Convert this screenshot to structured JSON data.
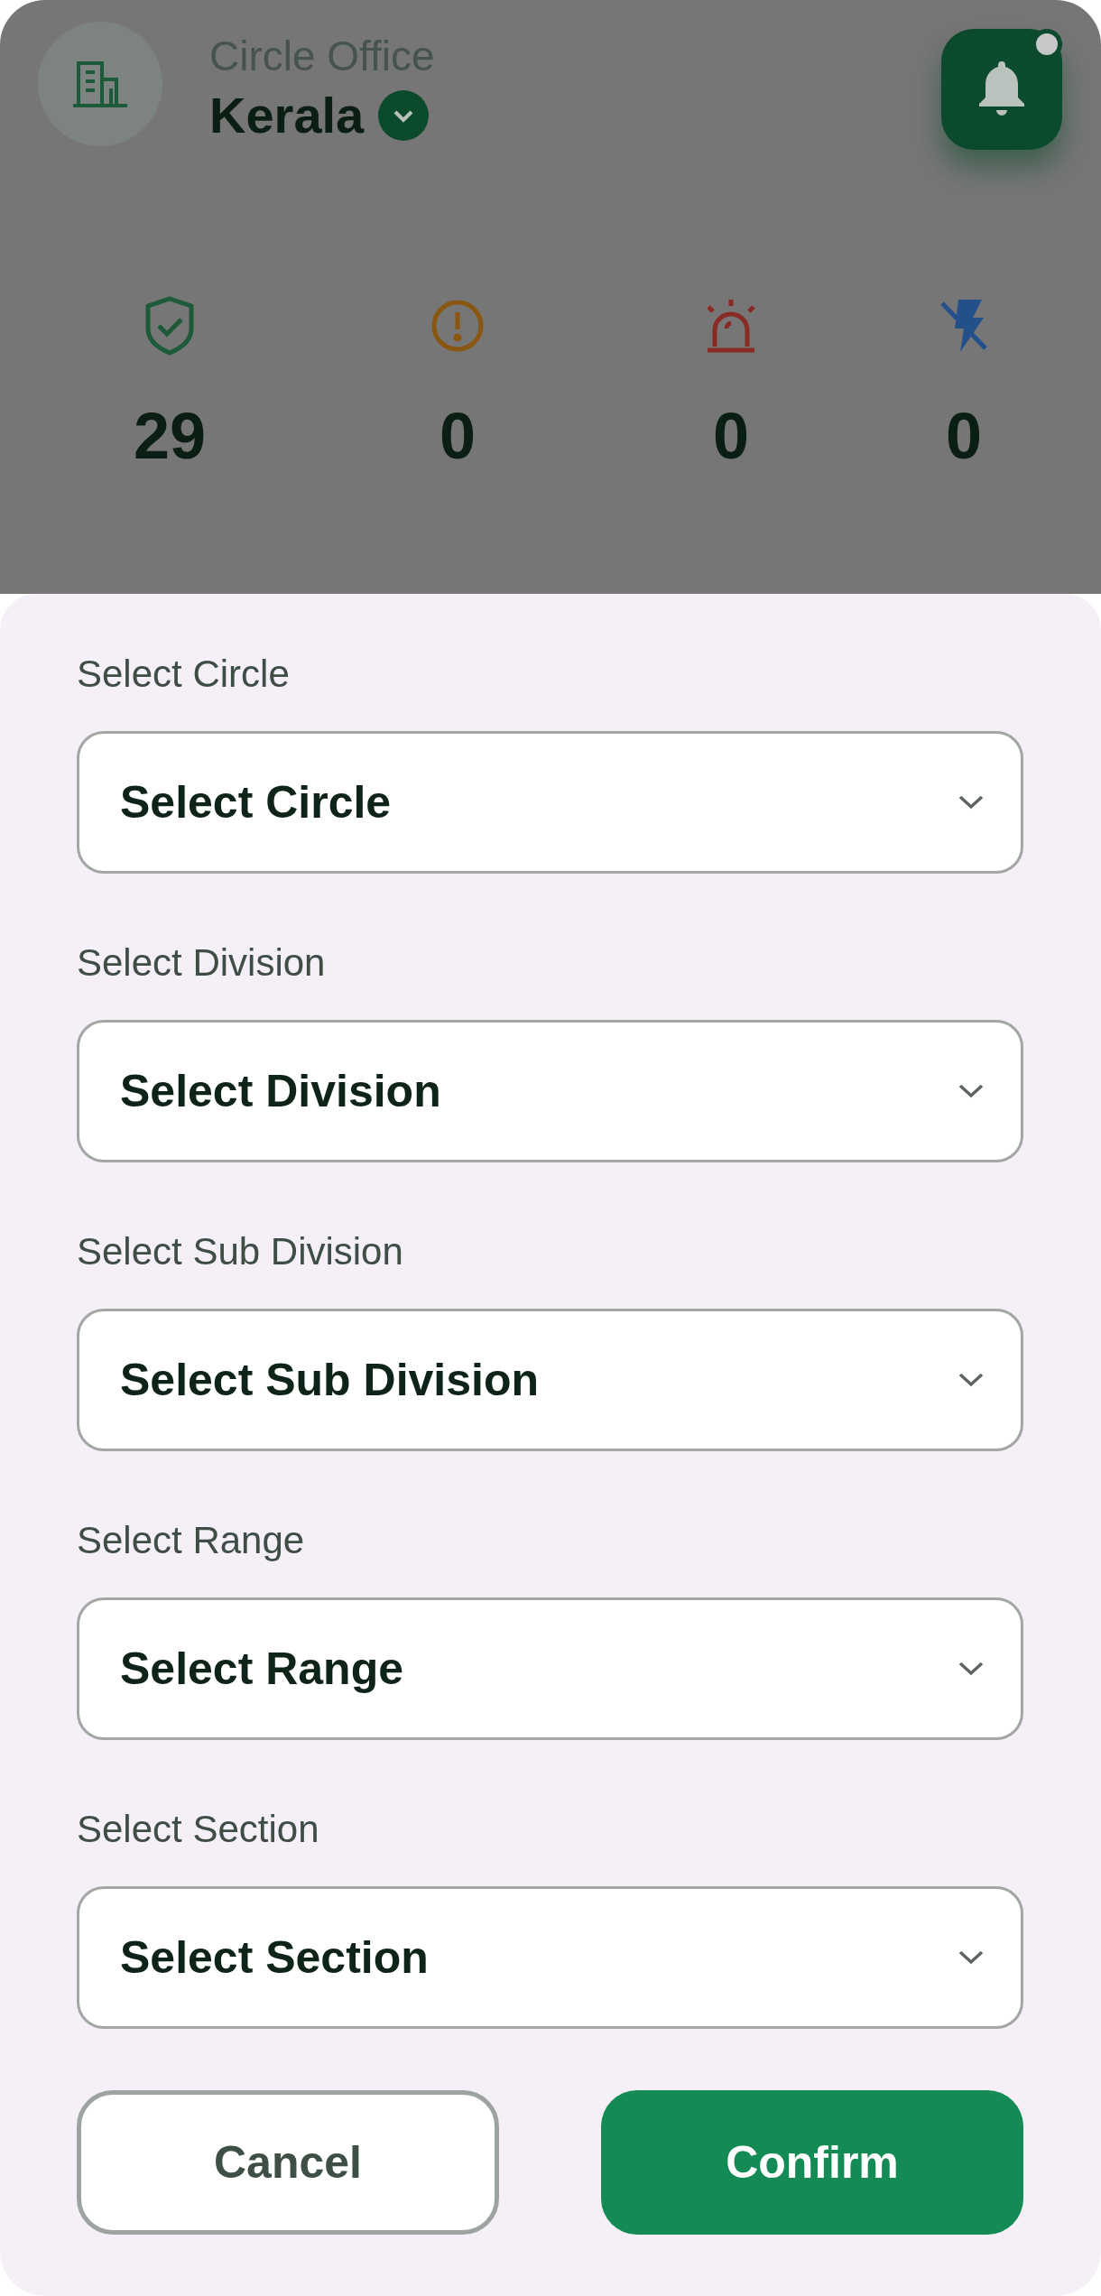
{
  "header": {
    "subtitle": "Circle Office",
    "title": "Kerala"
  },
  "stats": [
    {
      "kind": "shield",
      "value": "29",
      "color": "#1d5a3a"
    },
    {
      "kind": "alert",
      "value": "0",
      "color": "#8a5712"
    },
    {
      "kind": "siren",
      "value": "0",
      "color": "#8a2a25"
    },
    {
      "kind": "power-off",
      "value": "0",
      "color": "#234f8a"
    }
  ],
  "filters": [
    {
      "label": "Select Circle",
      "placeholder": "Select Circle"
    },
    {
      "label": "Select Division",
      "placeholder": "Select Division"
    },
    {
      "label": "Select Sub Division",
      "placeholder": "Select Sub Division"
    },
    {
      "label": "Select Range",
      "placeholder": "Select Range"
    },
    {
      "label": "Select Section",
      "placeholder": "Select Section"
    }
  ],
  "buttons": [
    {
      "kind": "secondary",
      "label": "Cancel"
    },
    {
      "kind": "primary",
      "label": "Confirm"
    }
  ]
}
